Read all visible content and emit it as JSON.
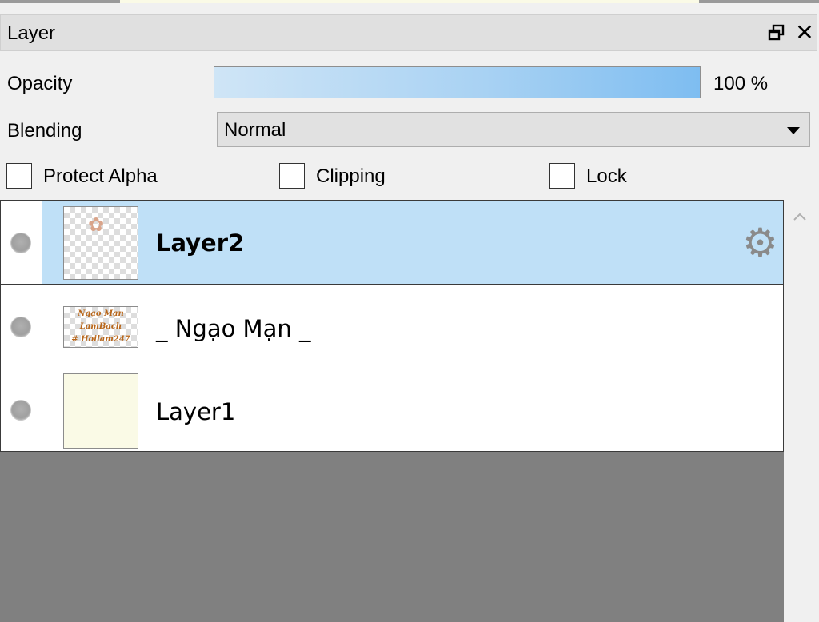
{
  "panel": {
    "title": "Layer",
    "icons": {
      "float": "float-window-icon",
      "close": "close-icon"
    },
    "close_glyph": "✕"
  },
  "opacity": {
    "label": "Opacity",
    "value_text": "100 %",
    "value": 100
  },
  "blending": {
    "label": "Blending",
    "selected": "Normal"
  },
  "options": {
    "protect_alpha": {
      "label": "Protect Alpha",
      "checked": false
    },
    "clipping": {
      "label": "Clipping",
      "checked": false
    },
    "lock": {
      "label": "Lock",
      "checked": false
    }
  },
  "layers": [
    {
      "name": "Layer2",
      "selected": true,
      "bold": true,
      "thumbnail": "transparent-sketch",
      "has_settings": true
    },
    {
      "name": "_ Ngạo Mạn _",
      "selected": false,
      "thumbnail": "text-watermark",
      "thumb_lines": [
        "Ngạo Mạn",
        "LamBach",
        "# Hoilam247"
      ]
    },
    {
      "name": "Layer1",
      "selected": false,
      "thumbnail": "solid-cream"
    }
  ],
  "colors": {
    "selected_row": "#bfe0f7",
    "opacity_bar_end": "#7ebdf1",
    "empty_area": "#808080"
  }
}
